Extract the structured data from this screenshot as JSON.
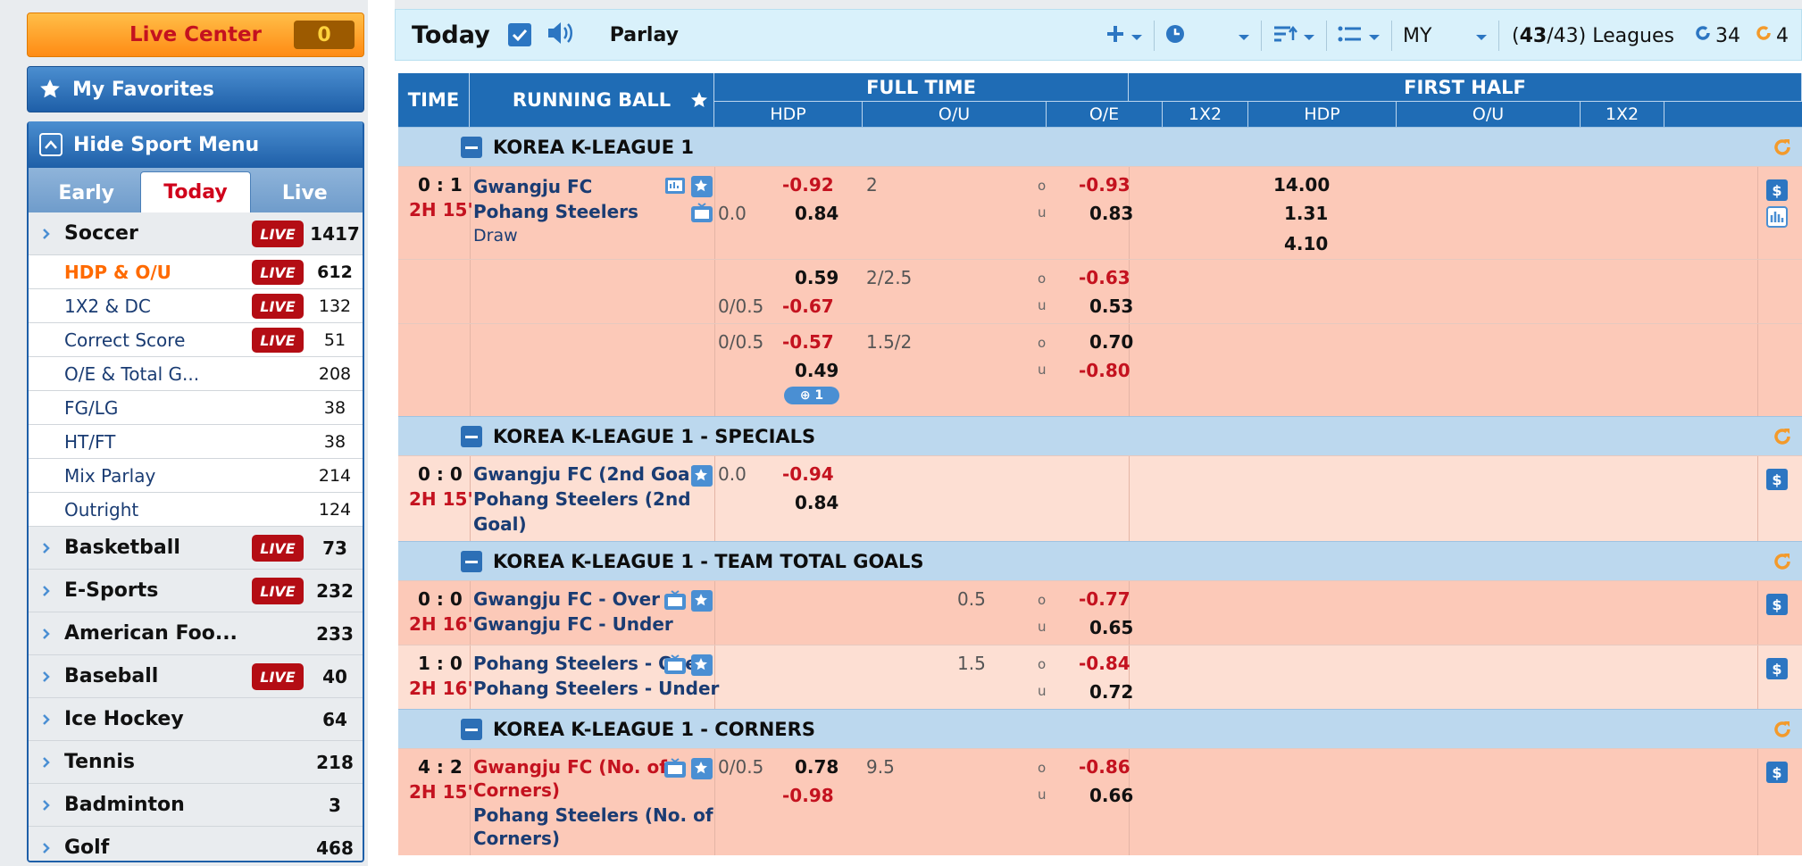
{
  "sidebar": {
    "live_center": {
      "label": "Live Center",
      "count": "0"
    },
    "favorites": {
      "label": "My Favorites"
    },
    "sport_menu": {
      "label": "Hide Sport Menu"
    },
    "tabs": [
      {
        "label": "Early",
        "active": false
      },
      {
        "label": "Today",
        "active": true
      },
      {
        "label": "Live",
        "active": false
      }
    ],
    "soccer": {
      "name": "Soccer",
      "live": "LIVE",
      "count": "1417"
    },
    "soccer_sub": [
      {
        "name": "HDP & O/U",
        "live": "LIVE",
        "count": "612",
        "selected": true
      },
      {
        "name": "1X2 & DC",
        "live": "LIVE",
        "count": "132"
      },
      {
        "name": "Correct Score",
        "live": "LIVE",
        "count": "51"
      },
      {
        "name": "O/E & Total G...",
        "count": "208"
      },
      {
        "name": "FG/LG",
        "count": "38"
      },
      {
        "name": "HT/FT",
        "count": "38"
      },
      {
        "name": "Mix Parlay",
        "count": "214"
      },
      {
        "name": "Outright",
        "count": "124"
      }
    ],
    "sports": [
      {
        "name": "Basketball",
        "live": "LIVE",
        "count": "73"
      },
      {
        "name": "E-Sports",
        "live": "LIVE",
        "count": "232"
      },
      {
        "name": "American Foo...",
        "count": "233"
      },
      {
        "name": "Baseball",
        "live": "LIVE",
        "count": "40"
      },
      {
        "name": "Ice Hockey",
        "count": "64"
      },
      {
        "name": "Tennis",
        "count": "218"
      },
      {
        "name": "Badminton",
        "count": "3"
      },
      {
        "name": "Golf",
        "count": "468"
      }
    ]
  },
  "toolbar": {
    "title": "Today",
    "parlay": "Parlay",
    "odds_type": "MY",
    "leagues_open": "(",
    "leagues_selected": "43",
    "leagues_total": "/43) Leagues",
    "refresh1": "34",
    "refresh2": "4"
  },
  "columns": {
    "time": "TIME",
    "running_ball": "RUNNING BALL",
    "full_time": "FULL TIME",
    "first_half": "FIRST HALF",
    "ft_hdp": "HDP",
    "ft_ou": "O/U",
    "ft_oe": "O/E",
    "ft_1x2": "1X2",
    "fh_hdp": "HDP",
    "fh_ou": "O/U",
    "fh_1x2": "1X2"
  },
  "leagues": [
    {
      "name": "KOREA K-LEAGUE 1"
    },
    {
      "name": "KOREA K-LEAGUE 1 - SPECIALS"
    },
    {
      "name": "KOREA K-LEAGUE 1 - TEAM TOTAL GOALS"
    },
    {
      "name": "KOREA K-LEAGUE 1 - CORNERS"
    }
  ],
  "m1": {
    "score": "0 : 1",
    "clock": "2H 15'",
    "home": "Gwangju FC",
    "away": "Pohang Steelers",
    "draw": "Draw",
    "hdp_line": "0.0",
    "hdp_home": "-0.92",
    "hdp_away": "0.84",
    "ou_line": "2",
    "over": "-0.93",
    "under": "0.83",
    "x1": "14.00",
    "x2": "1.31",
    "xx": "4.10"
  },
  "m1b": {
    "hdp_line": "0/0.5",
    "hdp_home": "0.59",
    "hdp_away": "-0.67",
    "ou_line": "2/2.5",
    "over": "-0.63",
    "under": "0.53"
  },
  "m1c": {
    "hdp_line": "0/0.5",
    "hdp_home": "-0.57",
    "hdp_away": "0.49",
    "ou_line": "1.5/2",
    "over": "0.70",
    "under": "-0.80",
    "more": "1"
  },
  "m2": {
    "score": "0 : 0",
    "clock": "2H 15'",
    "home": "Gwangju FC (2nd Goal)",
    "away1": "Pohang Steelers (2nd",
    "away2": "Goal)",
    "hdp_line": "0.0",
    "hdp_home": "-0.94",
    "hdp_away": "0.84"
  },
  "m3": {
    "score": "0 : 0",
    "clock": "2H 16'",
    "home": "Gwangju FC - Over",
    "away": "Gwangju FC - Under",
    "ou_line": "0.5",
    "over": "-0.77",
    "under": "0.65"
  },
  "m4": {
    "score": "1 : 0",
    "clock": "2H 16'",
    "home": "Pohang Steelers - Over",
    "away": "Pohang Steelers - Under",
    "ou_line": "1.5",
    "over": "-0.84",
    "under": "0.72"
  },
  "m5": {
    "score": "4 : 2",
    "clock": "2H 15'",
    "home1": "Gwangju FC (No. of",
    "home2": "Corners)",
    "away1": "Pohang Steelers (No. of",
    "away2": "Corners)",
    "hdp_line": "0/0.5",
    "hdp_home": "0.78",
    "hdp_away": "-0.98",
    "ou_line": "9.5",
    "over": "-0.86",
    "under": "0.66"
  },
  "ou_labels": {
    "o": "o",
    "u": "u"
  },
  "icons": {
    "favorites": "star-icon",
    "hide_menu": "chevron-up-icon",
    "sport_chevron": "chevron-right-icon",
    "speaker": "speaker-icon",
    "checkbox": "checkbox-icon",
    "add": "plus-icon",
    "clock": "clock-icon",
    "sort": "sort-icon",
    "list": "list-icon",
    "refresh": "refresh-icon",
    "tv": "tv-icon",
    "fav_star": "star-plus-icon",
    "dollar": "dollar-icon",
    "stats": "stats-icon"
  },
  "colors": {
    "accent_blue": "#1f6cb5",
    "live_red": "#b40d14",
    "negative_odds": "#c4121f",
    "row_live": "#fcc9b8",
    "row_light": "#fddfd3",
    "league_bar": "#bcd8ee",
    "refresh_orange": "#f39a2b"
  }
}
